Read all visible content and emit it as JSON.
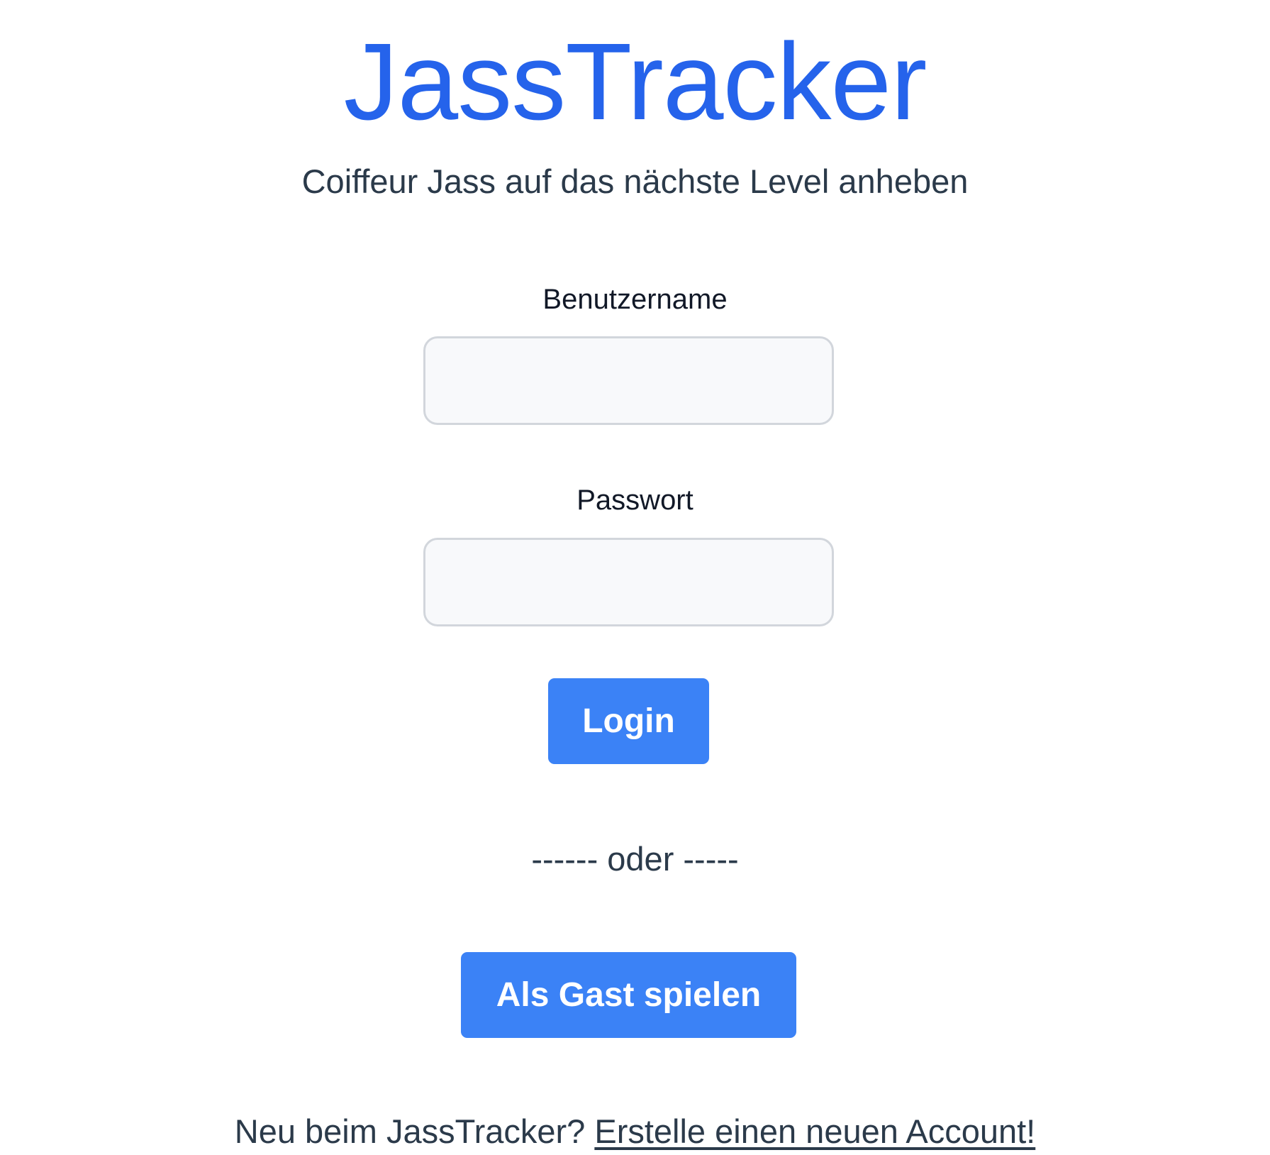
{
  "app": {
    "title": "JassTracker",
    "subtitle": "Coiffeur Jass auf das nächste Level anheben",
    "accent_color": "#2563eb"
  },
  "login_form": {
    "username_label": "Benutzername",
    "username_value": "",
    "password_label": "Passwort",
    "password_value": "",
    "login_button": "Login",
    "button_color": "#3b82f6"
  },
  "divider": {
    "text": "------ oder -----"
  },
  "guest": {
    "button_label": "Als Gast spielen"
  },
  "footer": {
    "prompt": "Neu beim JassTracker? ",
    "register_link": "Erstelle einen neuen Account!"
  }
}
